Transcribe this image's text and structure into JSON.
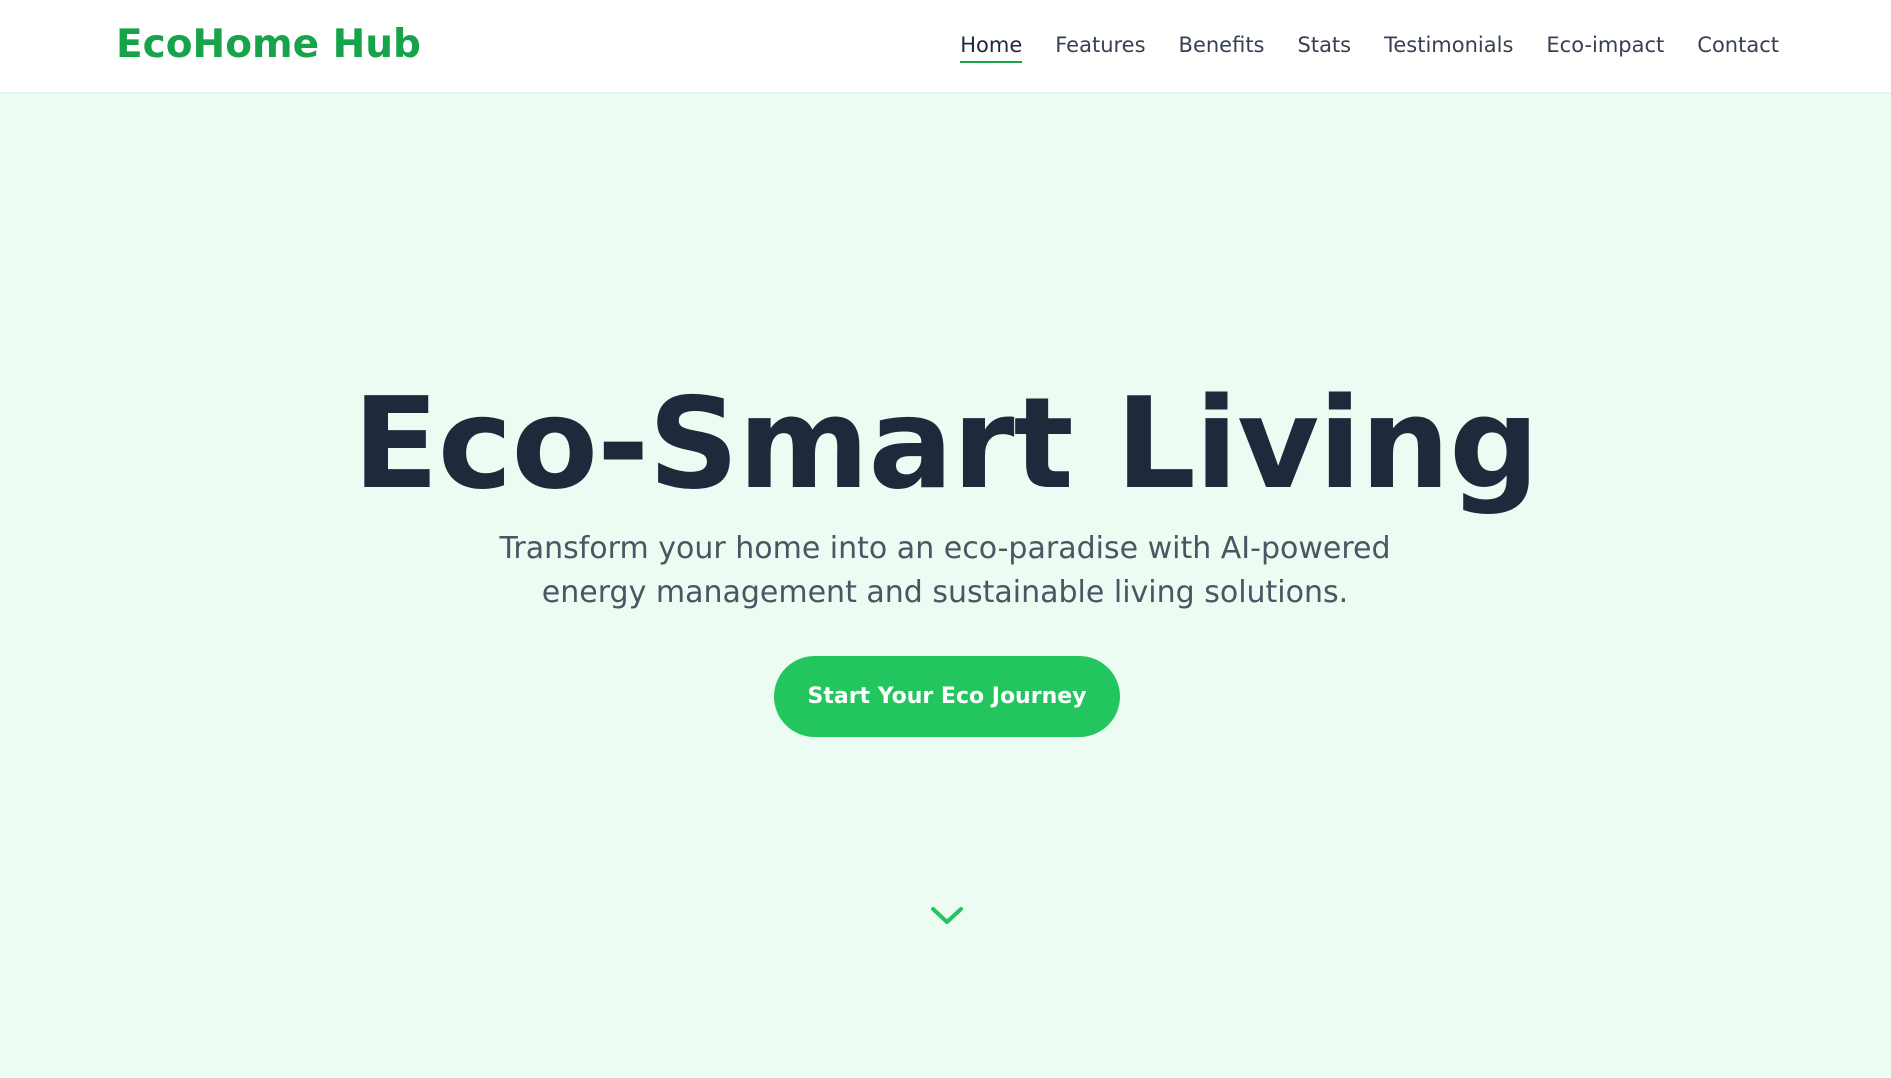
{
  "brand": {
    "name": "EcoHome Hub",
    "accent_color": "#16a34a",
    "button_color": "#22c55e",
    "background_color": "#ecfcf2"
  },
  "nav": {
    "items": [
      {
        "label": "Home",
        "active": true
      },
      {
        "label": "Features",
        "active": false
      },
      {
        "label": "Benefits",
        "active": false
      },
      {
        "label": "Stats",
        "active": false
      },
      {
        "label": "Testimonials",
        "active": false
      },
      {
        "label": "Eco-impact",
        "active": false
      },
      {
        "label": "Contact",
        "active": false
      }
    ]
  },
  "hero": {
    "title": "Eco-Smart Living",
    "subtitle": "Transform your home into an eco-paradise with AI-powered energy management and sustainable living solutions.",
    "cta_label": "Start Your Eco Journey",
    "scroll_icon": "chevron-down-icon"
  }
}
